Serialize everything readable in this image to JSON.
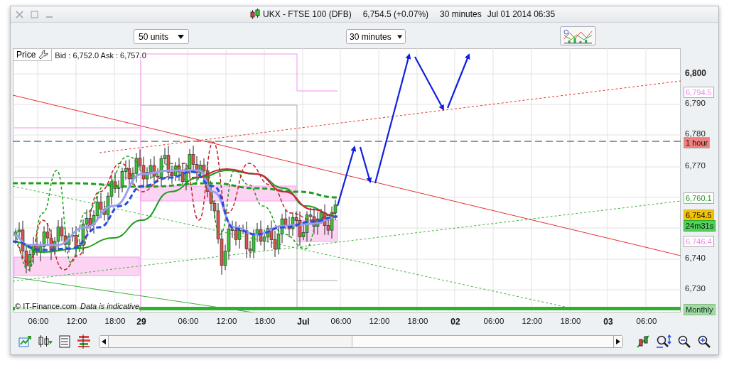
{
  "window": {
    "title": "UKX - FTSE 100 (DFB)",
    "price": "6,754.5 (+0.07%)",
    "interval": "30 minutes",
    "datetime": "Jul 01 2014 06:35"
  },
  "toolbar": {
    "units_dropdown": "50 units",
    "interval_dropdown": "30 minutes"
  },
  "chart": {
    "legend_button": "Price",
    "quote": "Bid : 6,752.0 Ask : 6,757.0",
    "copyright": "© IT-Finance.com",
    "disclaimer": "Data is indicative",
    "y_ticks": [
      {
        "label": "6,800",
        "kind": "major"
      },
      {
        "label": "6,790",
        "kind": "minor"
      },
      {
        "label": "6,780",
        "kind": "minor"
      },
      {
        "label": "6,770",
        "kind": "minor"
      },
      {
        "label": "6,740",
        "kind": "minor"
      },
      {
        "label": "6,730",
        "kind": "minor"
      }
    ],
    "badges": [
      {
        "label": "6,794.5",
        "kind": "marker"
      },
      {
        "label": "1 hour",
        "kind": "timeframe"
      },
      {
        "label": "6,760.1",
        "kind": "average"
      },
      {
        "label": "6,754.5",
        "kind": "last"
      },
      {
        "label": "24m31s",
        "kind": "countdown"
      },
      {
        "label": "6,746.4",
        "kind": "marker"
      },
      {
        "label": "Monthly",
        "kind": "period"
      }
    ],
    "x_ticks": [
      {
        "label": "06:00",
        "kind": "time"
      },
      {
        "label": "12:00",
        "kind": "time"
      },
      {
        "label": "18:00",
        "kind": "time"
      },
      {
        "label": "29",
        "kind": "day"
      },
      {
        "label": "06:00",
        "kind": "time"
      },
      {
        "label": "12:00",
        "kind": "time"
      },
      {
        "label": "18:00",
        "kind": "time"
      },
      {
        "label": "Jul",
        "kind": "day"
      },
      {
        "label": "06:00",
        "kind": "time"
      },
      {
        "label": "12:00",
        "kind": "time"
      },
      {
        "label": "18:00",
        "kind": "time"
      },
      {
        "label": "02",
        "kind": "day"
      },
      {
        "label": "06:00",
        "kind": "time"
      },
      {
        "label": "12:00",
        "kind": "time"
      },
      {
        "label": "18:00",
        "kind": "time"
      },
      {
        "label": "03",
        "kind": "day"
      },
      {
        "label": "06:00",
        "kind": "time"
      }
    ]
  }
}
